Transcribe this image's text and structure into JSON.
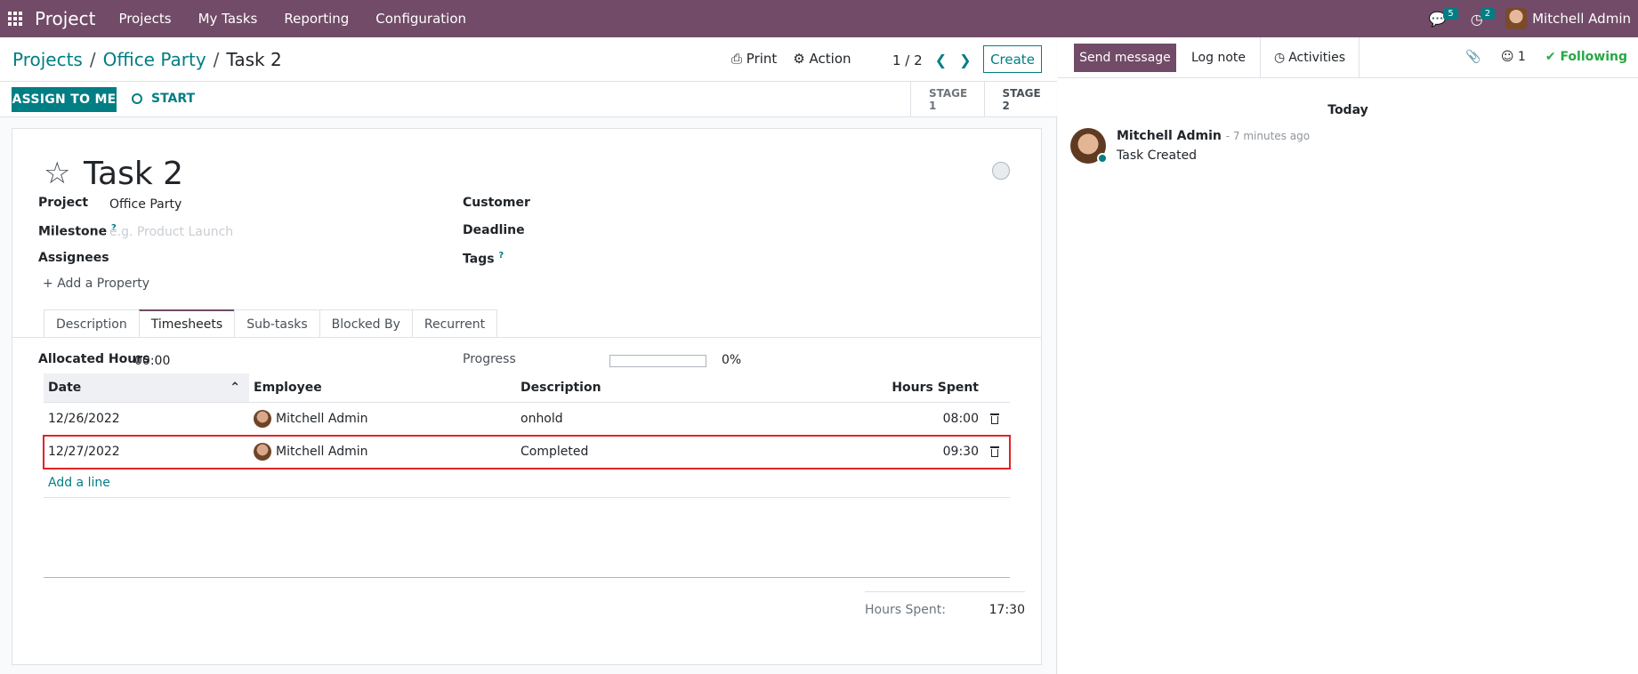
{
  "topbar": {
    "brand": "Project",
    "menu": [
      "Projects",
      "My Tasks",
      "Reporting",
      "Configuration"
    ],
    "messages_count": "5",
    "activities_count": "2",
    "user_name": "Mitchell Admin"
  },
  "breadcrumb": {
    "projects": "Projects",
    "sep1": "/",
    "project": "Office Party",
    "sep2": "/",
    "current": "Task 2"
  },
  "control_panel": {
    "print": "Print",
    "action": "Action",
    "pager": "1 / 2",
    "create": "Create"
  },
  "statusbar": {
    "assign": "ASSIGN TO ME",
    "start": "START",
    "stages": [
      "STAGE 1",
      "STAGE 2"
    ]
  },
  "task": {
    "title": "Task 2",
    "fields": {
      "project_label": "Project",
      "project_value": "Office Party",
      "milestone_label": "Milestone",
      "milestone_placeholder": "e.g. Product Launch",
      "assignees_label": "Assignees",
      "customer_label": "Customer",
      "deadline_label": "Deadline",
      "tags_label": "Tags",
      "help_mark": "?"
    },
    "add_property": "Add a Property"
  },
  "tabs": [
    "Description",
    "Timesheets",
    "Sub-tasks",
    "Blocked By",
    "Recurrent"
  ],
  "timesheets": {
    "allocated_label": "Allocated Hours",
    "allocated_value": "00:00",
    "progress_label": "Progress",
    "progress_value": "0%",
    "progress_fraction": 0,
    "columns": [
      "Date",
      "Employee",
      "Description",
      "Hours Spent"
    ],
    "rows": [
      {
        "date": "12/26/2022",
        "employee": "Mitchell Admin",
        "description": "onhold",
        "hours": "08:00"
      },
      {
        "date": "12/27/2022",
        "employee": "Mitchell Admin",
        "description": "Completed",
        "hours": "09:30"
      }
    ],
    "add_line": "Add a line",
    "total_label": "Hours Spent:",
    "total_value": "17:30"
  },
  "chatter": {
    "send_message": "Send message",
    "log_note": "Log note",
    "activities": "Activities",
    "followers_count": "1",
    "following": "Following",
    "today": "Today",
    "message": {
      "author": "Mitchell Admin",
      "time": "- 7 minutes ago",
      "body": "Task Created"
    }
  },
  "colors": {
    "brand": "#714b67",
    "accent": "#017e84",
    "highlight": "#e02424",
    "following": "#28a745"
  }
}
